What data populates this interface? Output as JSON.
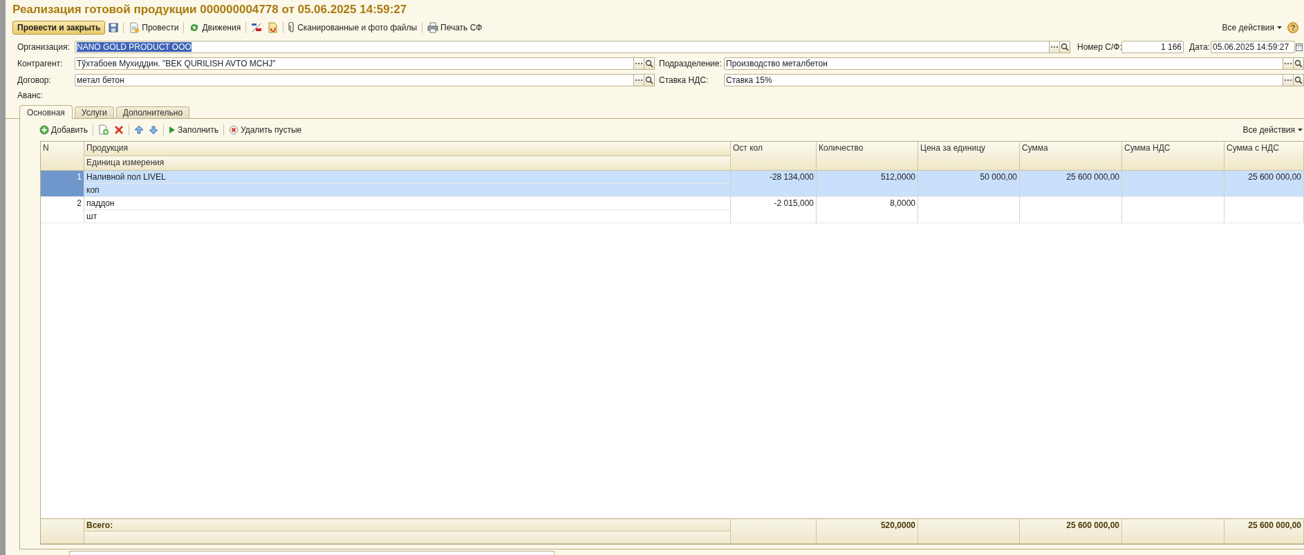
{
  "window": {
    "title": "Реализация готовой продукции 000000004778 от 05.06.2025 14:59:27"
  },
  "toolbar": {
    "items": [
      {
        "kind": "primary",
        "label": "Провести и закрыть"
      },
      {
        "kind": "icon"
      },
      {
        "kind": "separator"
      },
      {
        "kind": "icon_text",
        "label": "Провести"
      },
      {
        "kind": "separator"
      },
      {
        "kind": "icon_text",
        "label": "Движения"
      },
      {
        "kind": "separator"
      },
      {
        "kind": "icon"
      },
      {
        "kind": "icon"
      },
      {
        "kind": "separator"
      },
      {
        "kind": "icon_text",
        "label": "Сканированные и фото файлы"
      },
      {
        "kind": "separator"
      },
      {
        "kind": "icon_text",
        "label": "Печать СФ"
      }
    ],
    "all_actions": "Все действия",
    "help": "?"
  },
  "fields": {
    "organization": {
      "label": "Организация:",
      "value": "NANO GOLD PRODUCT OOO",
      "selected": true
    },
    "invoice_number": {
      "label": "Номер С/Ф:",
      "value": "1 166"
    },
    "date": {
      "label": "Дата:",
      "value": "05.06.2025 14:59:27"
    },
    "counterparty": {
      "label": "Контрагент:",
      "value": "Тўхтабоев Мухиддин. \"BEK QURILISH AVTO MCHJ\""
    },
    "division": {
      "label": "Подразделение:",
      "value": "Производство металбетон"
    },
    "contract": {
      "label": "Договор:",
      "value": "метал бетон"
    },
    "vat_rate": {
      "label": "Ставка НДС:",
      "value": "Ставка 15%"
    },
    "advance": {
      "label": "Аванс:"
    }
  },
  "tabs": [
    {
      "label": "Основная",
      "selected": true
    },
    {
      "label": "Услуги",
      "selected": false
    },
    {
      "label": "Дополнительно",
      "selected": false
    }
  ],
  "table_toolbar": {
    "items": [
      {
        "kind": "icon_text",
        "label": "Добавить"
      },
      {
        "kind": "separator"
      },
      {
        "kind": "icon"
      },
      {
        "kind": "icon"
      },
      {
        "kind": "separator"
      },
      {
        "kind": "icon"
      },
      {
        "kind": "icon"
      },
      {
        "kind": "separator"
      },
      {
        "kind": "icon_text",
        "label": "Заполнить"
      },
      {
        "kind": "separator"
      },
      {
        "kind": "icon_text",
        "label": "Удалить пустые"
      }
    ],
    "all_actions": "Все действия"
  },
  "grid": {
    "columns": [
      {
        "label": "N"
      },
      {
        "label": "Продукция",
        "sublabel": "Единица измерения"
      },
      {
        "label": "Ост кол"
      },
      {
        "label": "Количество"
      },
      {
        "label": "Цена за единицу"
      },
      {
        "label": "Сумма"
      },
      {
        "label": "Сумма НДС"
      },
      {
        "label": "Сумма с НДС"
      }
    ],
    "rows": [
      {
        "selected": true,
        "n": "1",
        "product": "Наливной пол LIVEL",
        "unit": "коп",
        "stock": "-28 134,000",
        "quantity": "512,0000",
        "price": "50 000,00",
        "amount": "25 600 000,00",
        "amount_with_vat": "25 600 000,00"
      },
      {
        "selected": false,
        "n": "2",
        "product": "паддон",
        "unit": "шт",
        "stock": "-2 015,000",
        "quantity": "8,0000"
      }
    ],
    "totals": {
      "label": "Всего:",
      "quantity": "520,0000",
      "amount": "25 600 000,00",
      "amount_with_vat": "25 600 000,00"
    }
  }
}
